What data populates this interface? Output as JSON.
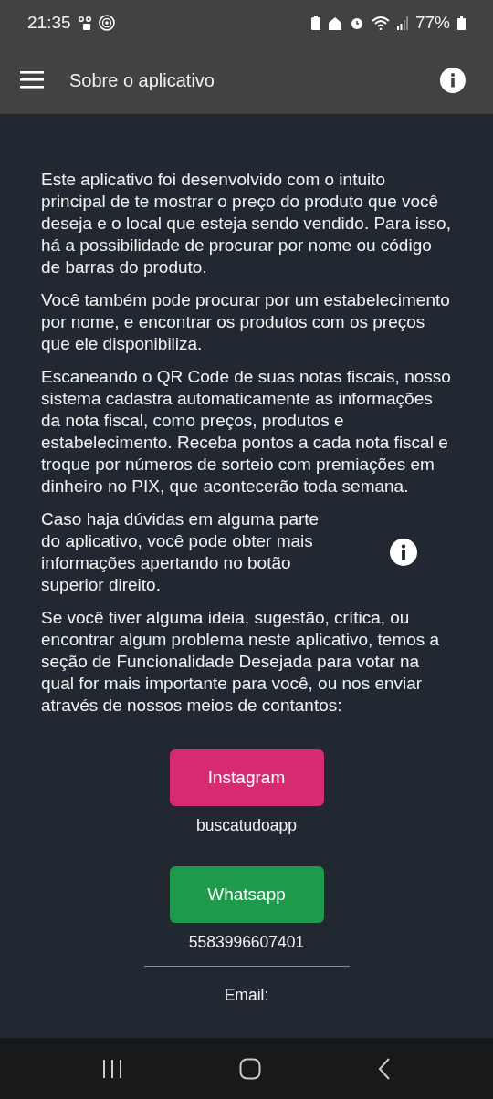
{
  "status_bar": {
    "time": "21:35",
    "battery": "77%"
  },
  "app_bar": {
    "title": "Sobre o aplicativo"
  },
  "paragraphs": [
    {
      "text": "Este aplicativo foi desenvolvido com o intuito principal de te mostrar o preço do produto que você deseja e o local que esteja sendo vendido. Para isso, há a possibilidade de procurar por nome ou código de barras do produto.",
      "with_info_icon": false
    },
    {
      "text": "Você também pode procurar por um estabelecimento por nome, e encontrar os produtos com os preços que ele disponibiliza.",
      "with_info_icon": false
    },
    {
      "text": "Escaneando o QR Code de suas notas fiscais, nosso sistema cadastra automaticamente as informações da nota fiscal, como preços, produtos e estabelecimento. Receba pontos a cada nota fiscal e troque por números de sorteio com premiações em dinheiro no PIX, que acontecerão toda semana.",
      "with_info_icon": false
    },
    {
      "text": "Caso haja dúvidas em alguma parte do aplicativo, você pode obter mais informações apertando no botão superior direito.",
      "with_info_icon": true
    },
    {
      "text": "Se você tiver alguma ideia, sugestão, crítica, ou encontrar algum problema neste aplicativo, temos a seção de Funcionalidade Desejada para votar na qual for mais importante para você, ou nos enviar através de nossos meios de contantos:",
      "with_info_icon": false
    }
  ],
  "contacts": [
    {
      "label": "Instagram",
      "value": "buscatudoapp",
      "color": "#d62b70"
    },
    {
      "label": "Whatsapp",
      "value": "5583996607401",
      "color": "#1e9a4b"
    }
  ],
  "email_heading": "Email:"
}
